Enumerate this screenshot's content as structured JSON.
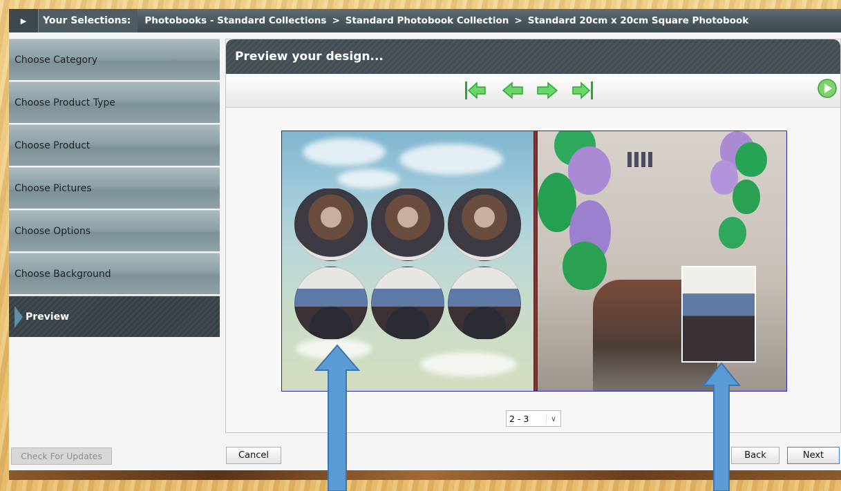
{
  "breadcrumb": {
    "label": "Your Selections:",
    "path": [
      "Photobooks - Standard Collections",
      "Standard Photobook Collection",
      "Standard 20cm x 20cm Square Photobook"
    ],
    "separator": ">"
  },
  "sidebar": {
    "items": [
      {
        "label": "Choose Category"
      },
      {
        "label": "Choose Product Type"
      },
      {
        "label": "Choose Product"
      },
      {
        "label": "Choose Pictures"
      },
      {
        "label": "Choose Options"
      },
      {
        "label": "Choose Background"
      },
      {
        "label": "Preview",
        "active": true
      }
    ],
    "check_updates_label": "Check For Updates"
  },
  "preview": {
    "title": "Preview your design...",
    "nav_icons": [
      "first-page-icon",
      "previous-page-icon",
      "next-page-icon",
      "last-page-icon"
    ],
    "play_icon": "play-icon",
    "page_selector_value": "2 - 3"
  },
  "buttons": {
    "cancel": "Cancel",
    "back": "Back",
    "next": "Next"
  },
  "colors": {
    "accent_green": "#3dc23d",
    "header_dark": "#4b565c",
    "annotation_blue": "#5b9bd5"
  }
}
